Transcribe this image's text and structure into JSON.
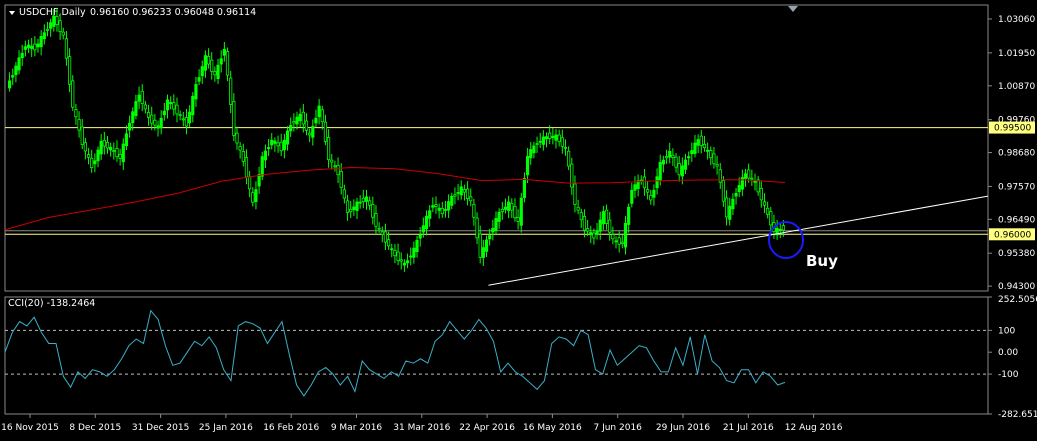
{
  "chart_data": {
    "type": "candlestick",
    "symbol_header": "USDCHF,Daily",
    "ohlc_header": "0.96160 0.96233 0.96048 0.96114",
    "price_axis_ticks": [
      "1.03060",
      "1.01950",
      "1.00870",
      "0.99760",
      "0.98680",
      "0.97570",
      "0.96490",
      "0.95380",
      "0.94300"
    ],
    "price_ticks_values": [
      1.0306,
      1.0195,
      1.0087,
      0.9976,
      0.9868,
      0.9757,
      0.9649,
      0.9538,
      0.943
    ],
    "ylim": [
      0.9414,
      1.0352
    ],
    "price_levels": [
      {
        "value": 0.995,
        "label": "0.99500",
        "color": "#ffff80"
      },
      {
        "value": 0.96,
        "label": "0.96000",
        "color": "#ffff80"
      }
    ],
    "current_price": 0.96114,
    "date_labels": [
      "16 Nov 2015",
      "8 Dec 2015",
      "31 Dec 2015",
      "25 Jan 2016",
      "16 Feb 2016",
      "9 Mar 2016",
      "31 Mar 2016",
      "22 Apr 2016",
      "16 May 2016",
      "7 Jun 2016",
      "29 Jun 2016",
      "21 Jul 2016",
      "12 Aug 2016"
    ],
    "close_series": [
      1.008,
      1.015,
      1.022,
      1.021,
      1.026,
      1.031,
      1.025,
      1.002,
      0.99,
      0.982,
      0.99,
      0.988,
      0.985,
      0.997,
      1.006,
      0.998,
      0.995,
      1.004,
      1.0,
      0.996,
      1.009,
      1.018,
      1.012,
      1.021,
      0.993,
      0.984,
      0.97,
      0.985,
      0.991,
      0.988,
      0.996,
      0.999,
      0.992,
      1.002,
      0.985,
      0.98,
      0.967,
      0.97,
      0.972,
      0.963,
      0.958,
      0.953,
      0.95,
      0.955,
      0.963,
      0.97,
      0.967,
      0.972,
      0.975,
      0.971,
      0.953,
      0.96,
      0.967,
      0.97,
      0.964,
      0.986,
      0.99,
      0.992,
      0.992,
      0.988,
      0.97,
      0.962,
      0.959,
      0.967,
      0.958,
      0.957,
      0.975,
      0.978,
      0.971,
      0.983,
      0.987,
      0.98,
      0.986,
      0.991,
      0.987,
      0.982,
      0.966,
      0.974,
      0.98,
      0.977,
      0.969,
      0.961,
      0.962
    ],
    "ma": {
      "name": "",
      "color": "#cc0000",
      "values": [
        0.9615,
        0.9655,
        0.968,
        0.9706,
        0.9735,
        0.9774,
        0.9796,
        0.981,
        0.9819,
        0.9815,
        0.9799,
        0.9776,
        0.978,
        0.9768,
        0.9769,
        0.9775,
        0.9778,
        0.9779,
        0.977
      ]
    },
    "trendline": {
      "start": {
        "date_index": 0,
        "value": 0.9433
      },
      "end": {
        "date_index": 1,
        "value": 0.9725
      }
    },
    "annotation": {
      "text": "Buy"
    },
    "indicator": {
      "name": "CCI(20) -138.2464",
      "axis_ticks": [
        "252.5056",
        "100",
        "0.00",
        "-100",
        "-282.6519"
      ],
      "axis_values": [
        252.5056,
        100,
        0,
        -100,
        -282.6519
      ],
      "levels": [
        100,
        -100
      ],
      "color": "#3ab0c8",
      "values": [
        0,
        90,
        140,
        120,
        160,
        90,
        40,
        40,
        -110,
        -160,
        -90,
        -120,
        -80,
        -90,
        -110,
        -80,
        -30,
        30,
        60,
        40,
        190,
        150,
        30,
        -60,
        -50,
        0,
        50,
        30,
        70,
        20,
        -80,
        -130,
        120,
        140,
        130,
        110,
        40,
        90,
        140,
        -10,
        -150,
        -200,
        -150,
        -90,
        -70,
        -100,
        -150,
        -110,
        -180,
        -40,
        -80,
        -100,
        -120,
        -90,
        -110,
        -40,
        -50,
        -30,
        -50,
        50,
        80,
        140,
        100,
        60,
        100,
        150,
        110,
        50,
        -90,
        -50,
        -90,
        -110,
        -140,
        -170,
        -130,
        40,
        70,
        60,
        30,
        100,
        80,
        -80,
        -100,
        10,
        -60,
        -30,
        0,
        30,
        20,
        -40,
        -90,
        -90,
        20,
        -60,
        70,
        -100,
        80,
        -40,
        -70,
        -130,
        -140,
        -80,
        -80,
        -140,
        -90,
        -110,
        -150,
        -138
      ]
    }
  }
}
